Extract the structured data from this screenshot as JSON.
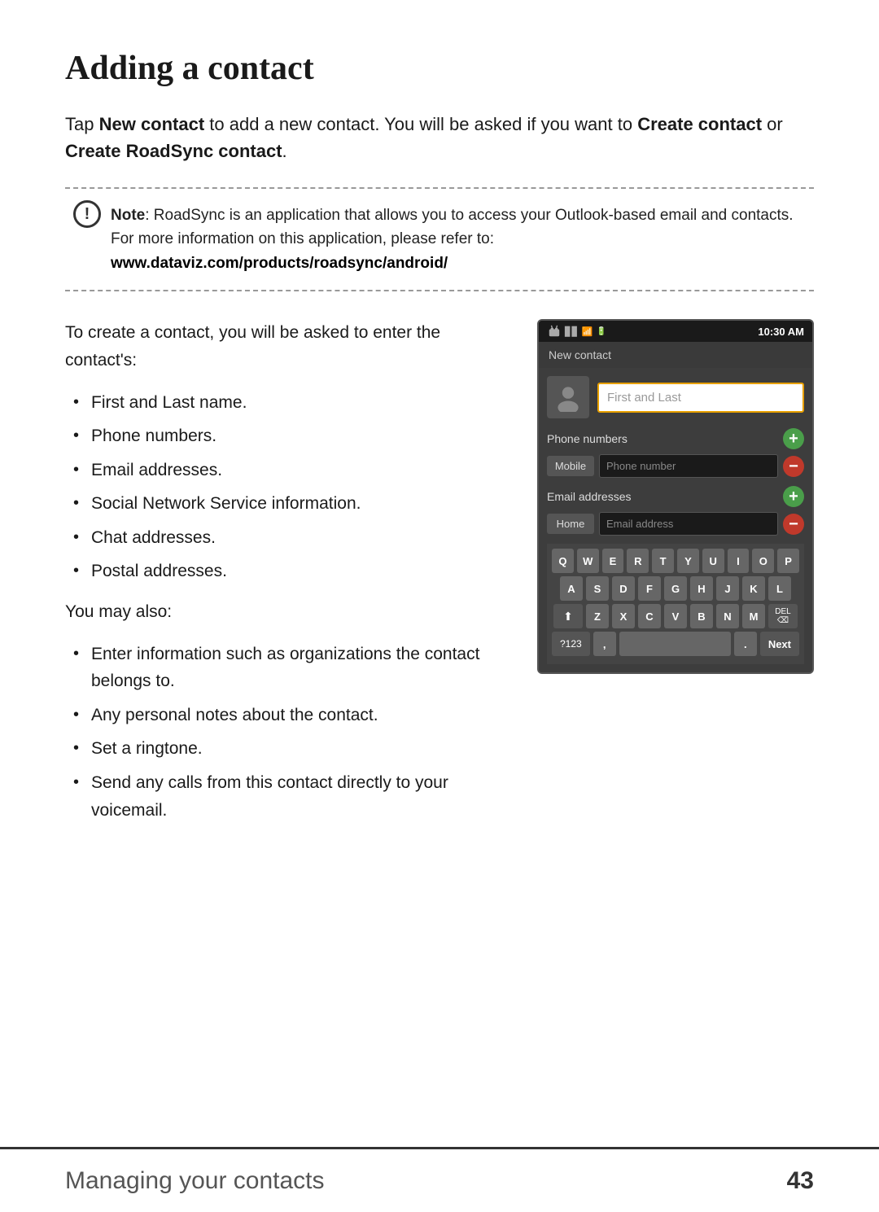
{
  "page": {
    "title": "Adding a contact",
    "intro": {
      "part1": "Tap ",
      "bold1": "New contact",
      "part2": " to add a new contact. You will be asked if you want to ",
      "bold2": "Create contact",
      "part3": " or ",
      "bold3": "Create RoadSync contact",
      "part4": "."
    },
    "note": {
      "text": ": RoadSync is an application that allows you to access your Outlook-based email and contacts. For more information on this application, please refer to:",
      "bold_label": "Note",
      "url": "www.dataviz.com/products/roadsync/android/"
    },
    "intro2": "To create a contact, you will be asked to enter the contact's:",
    "bullets1": [
      "First and Last name.",
      "Phone numbers.",
      "Email addresses.",
      "Social Network Service information.",
      "Chat addresses.",
      "Postal addresses."
    ],
    "also": "You may also:",
    "bullets2": [
      "Enter information such as organizations the contact belongs to.",
      "Any personal notes about the contact.",
      "Set a ringtone.",
      "Send any calls from this contact directly to your voicemail."
    ],
    "phone": {
      "status_bar": {
        "time": "10:30 AM"
      },
      "header": "New contact",
      "name_placeholder": "First and Last",
      "phone_section": "Phone numbers",
      "phone_type": "Mobile",
      "phone_placeholder": "Phone number",
      "email_section": "Email addresses",
      "email_type": "Home",
      "email_placeholder": "Email address",
      "keyboard": {
        "row1": [
          "Q",
          "W",
          "E",
          "R",
          "T",
          "Y",
          "U",
          "I",
          "O",
          "P"
        ],
        "row2": [
          "A",
          "S",
          "D",
          "F",
          "G",
          "H",
          "J",
          "K",
          "L"
        ],
        "row3": [
          "Z",
          "X",
          "C",
          "V",
          "B",
          "N",
          "M"
        ],
        "bottom": {
          "sym": "?123",
          "comma": ",",
          "period": ".",
          "next": "Next"
        }
      }
    },
    "footer": {
      "title": "Managing your contacts",
      "page": "43"
    }
  }
}
